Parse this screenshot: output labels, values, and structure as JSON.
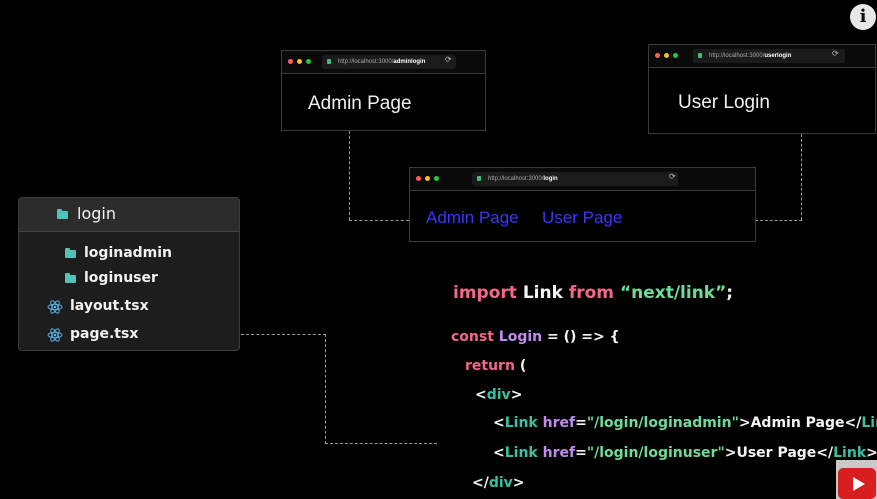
{
  "windows": {
    "admin": {
      "url_prefix": "http://localhost:3000/",
      "url_path": "adminlogin",
      "title": "Admin Page"
    },
    "user": {
      "url_prefix": "http://localhost:3000/",
      "url_path": "userlogin",
      "title": "User Login"
    },
    "login": {
      "url_prefix": "http://localhost:3000/",
      "url_path": "login",
      "link_admin": "Admin Page",
      "link_user": "User Page"
    }
  },
  "file_tree": {
    "root": "login",
    "items": [
      "loginadmin",
      "loginuser",
      "layout.tsx",
      "page.tsx"
    ]
  },
  "code": {
    "line1": {
      "kw1": "import",
      "name": "Link",
      "kw2": "from",
      "str": "“next/link”",
      "end": ";"
    },
    "line2": {
      "kw": "const",
      "name": "Login",
      "rest": "= () =>",
      "brace": "{"
    },
    "line3": {
      "kw": "return",
      "paren": "("
    },
    "line4": {
      "open": "<",
      "tag": "div",
      "close": ">"
    },
    "line5": {
      "open": "<",
      "tag": "Link",
      "attr": "href",
      "eq": "=",
      "str": "\"/login/loginadmin\"",
      "text": ">Admin Page</",
      "tag2": "Link"
    },
    "line6": {
      "open": "<",
      "tag": "Link",
      "attr": "href",
      "eq": "=",
      "str": "\"/login/loginuser\"",
      "text": ">User Page</",
      "tag2": "Link",
      "end": ">"
    },
    "line7": {
      "open": "</",
      "tag": "div",
      "close": ">"
    }
  },
  "icons": {
    "info": "info-icon",
    "youtube": "youtube-play-icon",
    "react": "react-icon",
    "folder": "folder-icon"
  },
  "info_glyph": "i"
}
